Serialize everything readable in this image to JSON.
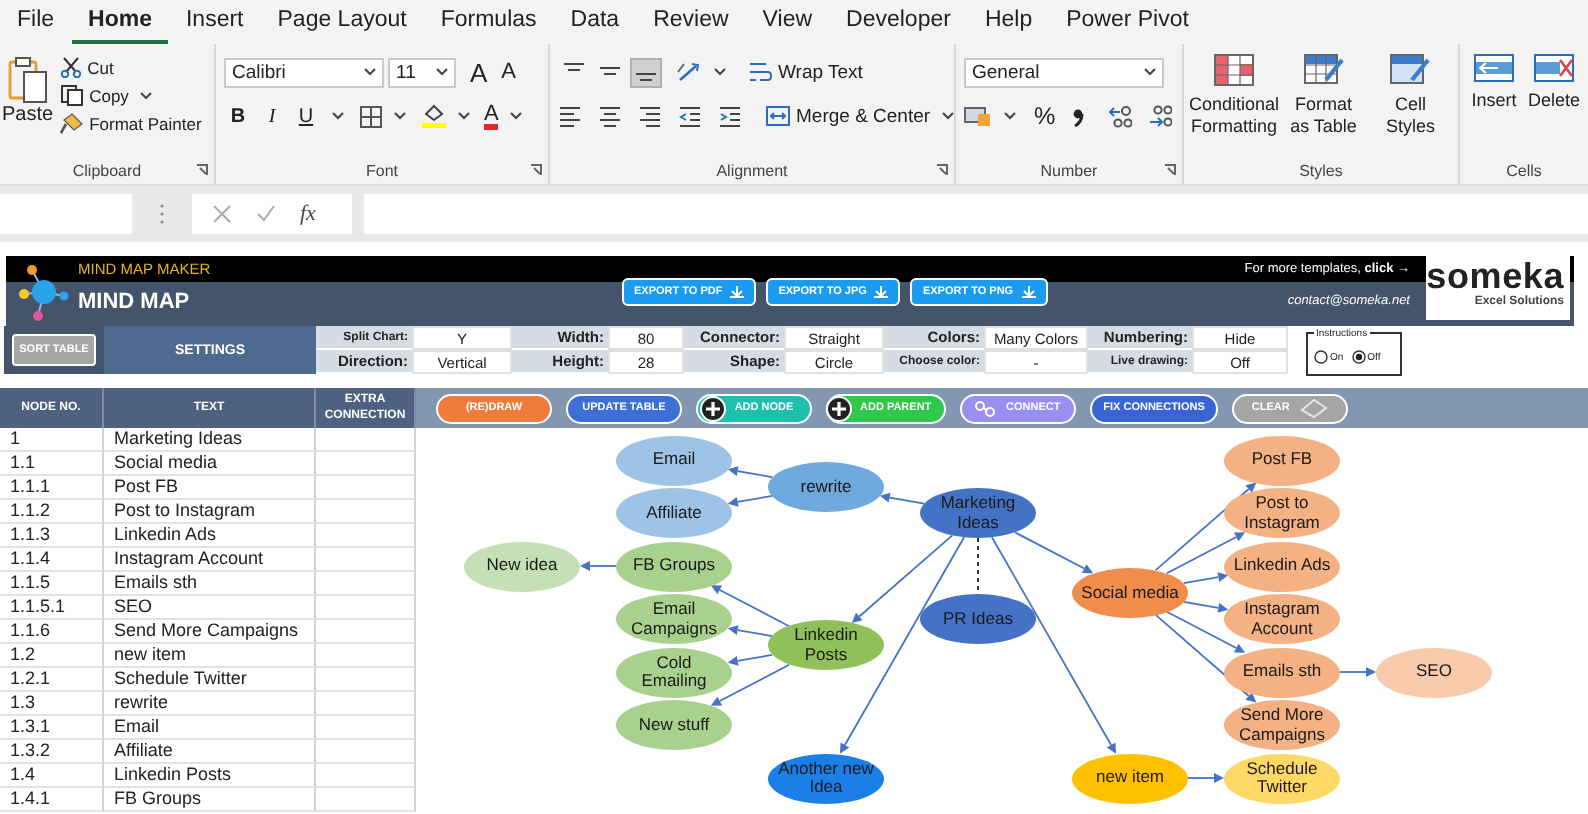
{
  "ribbon": {
    "tabs": [
      {
        "label": "File",
        "selected": false
      },
      {
        "label": "Home",
        "selected": true
      },
      {
        "label": "Insert",
        "selected": false
      },
      {
        "label": "Page Layout",
        "selected": false
      },
      {
        "label": "Formulas",
        "selected": false
      },
      {
        "label": "Data",
        "selected": false
      },
      {
        "label": "Review",
        "selected": false
      },
      {
        "label": "View",
        "selected": false
      },
      {
        "label": "Developer",
        "selected": false
      },
      {
        "label": "Help",
        "selected": false
      },
      {
        "label": "Power Pivot",
        "selected": false
      }
    ],
    "clipboard": {
      "paste": "Paste",
      "cut": "Cut",
      "copy": "Copy",
      "format_painter": "Format Painter",
      "label": "Clipboard"
    },
    "font": {
      "name": "Calibri",
      "size": "11",
      "grow": "A",
      "shrink": "A",
      "bold": "B",
      "italic": "I",
      "underline": "U",
      "font_color": "A",
      "label": "Font"
    },
    "alignment": {
      "vertical": [
        {
          "selected": false
        },
        {
          "selected": false
        },
        {
          "selected": true
        }
      ],
      "wrap_text": "Wrap Text",
      "merge": "Merge & Center",
      "label": "Alignment"
    },
    "number": {
      "format": "General",
      "percent": "%",
      "label": "Number"
    },
    "styles": {
      "items": [
        "Conditional Formatting",
        "Format as Table",
        "Cell Styles"
      ],
      "label": "Styles"
    },
    "cells": {
      "items": [
        "Insert",
        "Delete"
      ],
      "label": "Cells"
    }
  },
  "formula_bar": {
    "fx": "fx"
  },
  "header": {
    "subtitle": "MIND MAP MAKER",
    "title": "MIND MAP",
    "exports": [
      "EXPORT TO PDF",
      "EXPORT TO JPG",
      "EXPORT TO PNG"
    ],
    "promo": "For more templates, **click →**",
    "contact": "contact@someka.net",
    "logo": "someka",
    "logo_tagline": "Excel Solutions"
  },
  "settings": {
    "sort_button": "SORT TABLE",
    "title": "SETTINGS",
    "columns": [
      [
        {
          "label": "Split Chart:",
          "value": "Y"
        },
        {
          "label": "Direction:",
          "value": "Vertical"
        }
      ],
      [
        {
          "label": "Width:",
          "value": "80"
        },
        {
          "label": "Height:",
          "value": "28"
        }
      ],
      [
        {
          "label": "Connector:",
          "value": "Straight"
        },
        {
          "label": "Shape:",
          "value": "Circle"
        }
      ],
      [
        {
          "label": "Colors:",
          "value": "Many Colors"
        },
        {
          "label": "Choose color:",
          "value": "-"
        }
      ],
      [
        {
          "label": "Numbering:",
          "value": "Hide"
        },
        {
          "label": "Live drawing:",
          "value": "Off"
        }
      ]
    ],
    "instructions": {
      "title": "Instructions",
      "options": [
        {
          "label": "On",
          "selected": false
        },
        {
          "label": "Off",
          "selected": true
        }
      ]
    }
  },
  "toolbar": [
    {
      "label": "(RE)DRAW",
      "color": "#f07c3c"
    },
    {
      "label": "UPDATE TABLE",
      "color": "#3d6fd6"
    },
    {
      "label": "ADD NODE",
      "color": "#1fbfae"
    },
    {
      "label": "ADD PARENT",
      "color": "#2ec84a"
    },
    {
      "label": "CONNECT",
      "color": "#9a8ef0"
    },
    {
      "label": "FIX CONNECTIONS",
      "color": "#3a64d4"
    },
    {
      "label": "CLEAR",
      "color": "#a5a5a5"
    }
  ],
  "table": {
    "columns": [
      "NODE NO.",
      "TEXT",
      "EXTRA CONNECTION"
    ],
    "rows": [
      {
        "node_no": "1",
        "text": "Marketing Ideas"
      },
      {
        "node_no": "1.1",
        "text": "Social media"
      },
      {
        "node_no": "1.1.1",
        "text": "Post FB"
      },
      {
        "node_no": "1.1.2",
        "text": "Post to Instagram"
      },
      {
        "node_no": "1.1.3",
        "text": "Linkedin Ads"
      },
      {
        "node_no": "1.1.4",
        "text": "Instagram Account"
      },
      {
        "node_no": "1.1.5",
        "text": "Emails sth"
      },
      {
        "node_no": "1.1.5.1",
        "text": "SEO"
      },
      {
        "node_no": "1.1.6",
        "text": "Send More Campaigns"
      },
      {
        "node_no": "1.2",
        "text": "new item"
      },
      {
        "node_no": "1.2.1",
        "text": "Schedule Twitter"
      },
      {
        "node_no": "1.3",
        "text": "rewrite"
      },
      {
        "node_no": "1.3.1",
        "text": "Email"
      },
      {
        "node_no": "1.3.2",
        "text": "Affiliate"
      },
      {
        "node_no": "1.4",
        "text": "Linkedin Posts"
      },
      {
        "node_no": "1.4.1",
        "text": "FB Groups"
      }
    ]
  },
  "map": {
    "root": {
      "text": "Marketing Ideas",
      "color": "#4472c4",
      "children": [
        {
          "text": "Social media",
          "color": "#f08c4c",
          "children": [
            {
              "text": "Post FB",
              "color": "#f4b183"
            },
            {
              "text": "Post to Instagram",
              "color": "#f4b183"
            },
            {
              "text": "Linkedin Ads",
              "color": "#f4b183"
            },
            {
              "text": "Instagram Account",
              "color": "#f4b183"
            },
            {
              "text": "Emails sth",
              "color": "#f4b183",
              "children": [
                {
                  "text": "SEO",
                  "color": "#f8cbad"
                }
              ]
            },
            {
              "text": "Send More Campaigns",
              "color": "#f4b183"
            }
          ]
        },
        {
          "text": "new item",
          "color": "#ffc000",
          "children": [
            {
              "text": "Schedule Twitter",
              "color": "#ffd966"
            }
          ]
        },
        {
          "text": "rewrite",
          "color": "#6fa8dc",
          "children": [
            {
              "text": "Email",
              "color": "#9dc3e6"
            },
            {
              "text": "Affiliate",
              "color": "#9dc3e6"
            }
          ]
        },
        {
          "text": "Linkedin Posts",
          "color": "#8fc05a",
          "children": [
            {
              "text": "FB Groups",
              "color": "#a9d18e",
              "children": [
                {
                  "text": "New idea",
                  "color": "#c5e0b4"
                }
              ]
            },
            {
              "text": "Email Campaigns",
              "color": "#a9d18e"
            },
            {
              "text": "Cold Emailing",
              "color": "#a9d18e"
            },
            {
              "text": "New stuff",
              "color": "#a9d18e"
            }
          ]
        },
        {
          "text": "Another new Idea",
          "color": "#1a7fe6"
        },
        {
          "text": "PR Ideas",
          "color": "#4472c4"
        }
      ]
    }
  }
}
